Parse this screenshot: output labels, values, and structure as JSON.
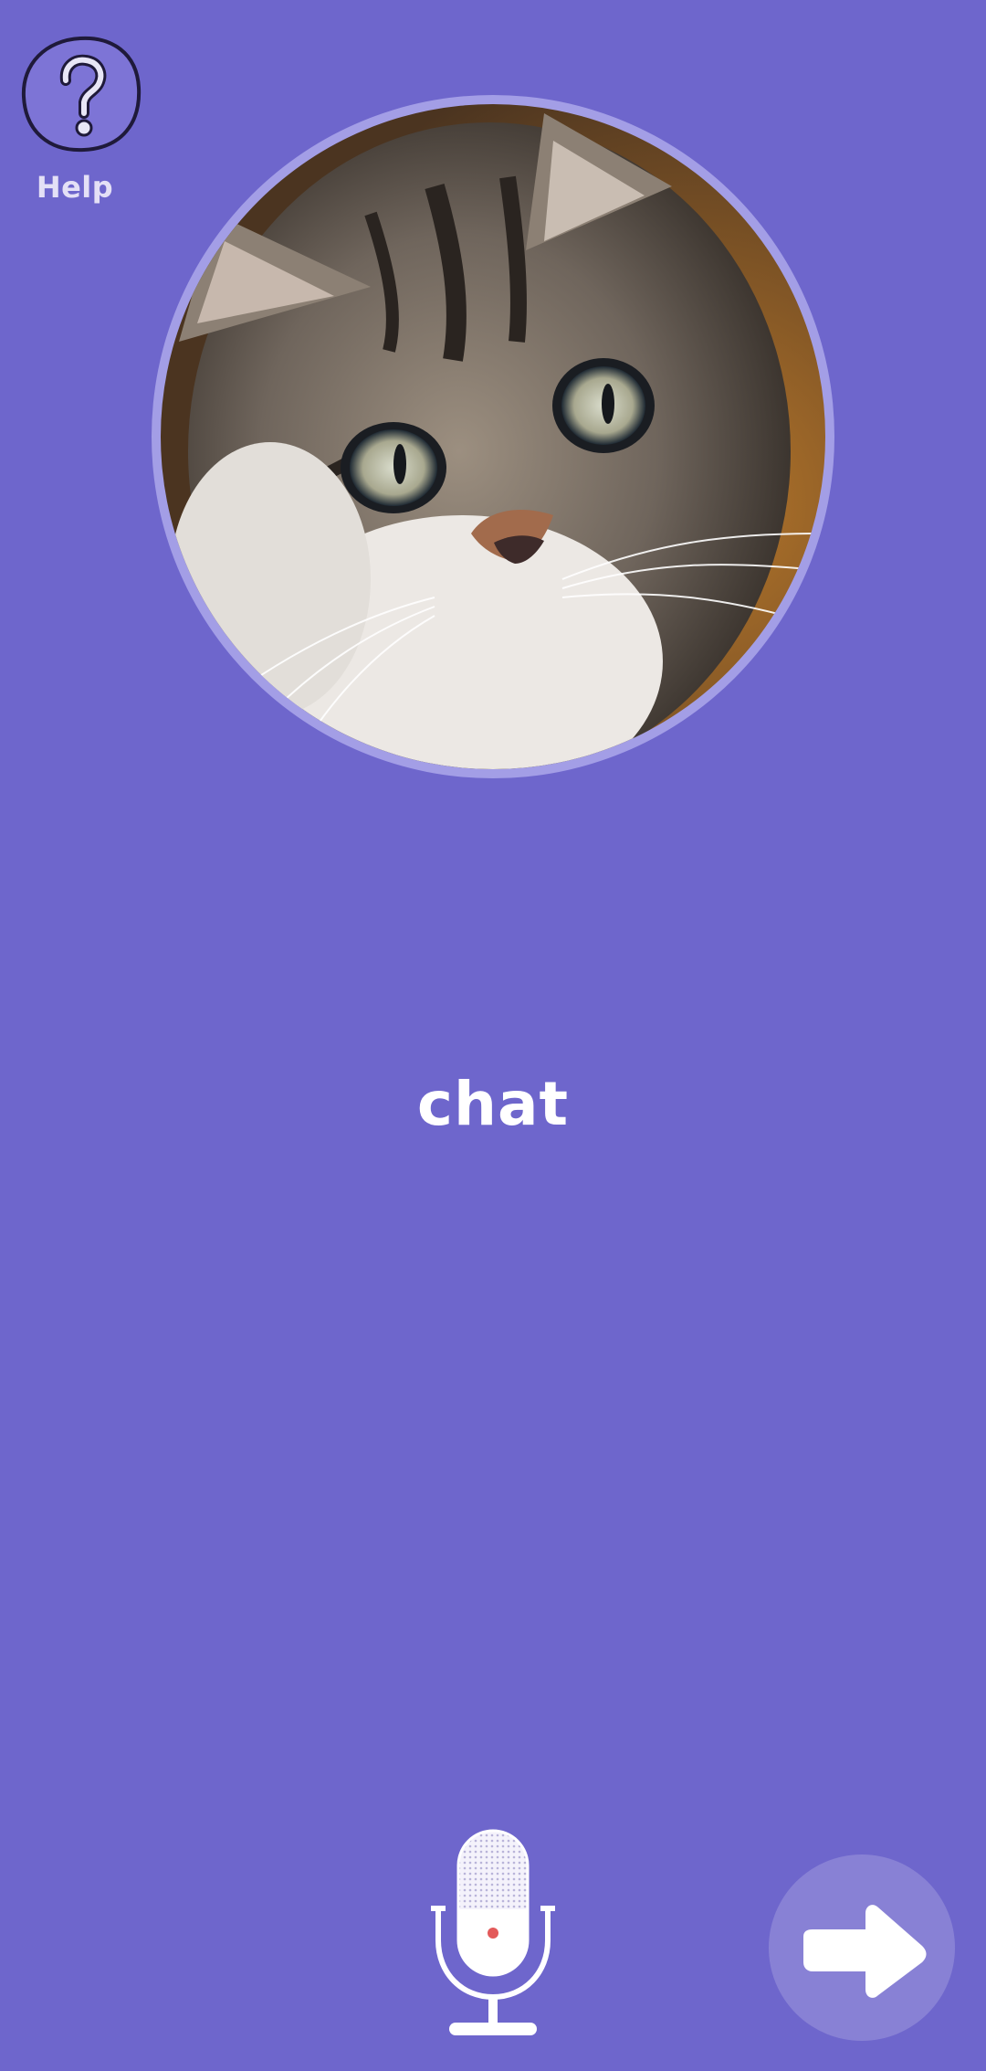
{
  "help": {
    "label": "Help",
    "icon": "question-mark-icon"
  },
  "card": {
    "image": "kitten-photo",
    "word": "chat"
  },
  "controls": {
    "microphone_icon": "microphone-icon",
    "next_icon": "arrow-right-icon"
  },
  "colors": {
    "background": "#6e66cc",
    "frame": "#a39ee6",
    "text": "#ffffff"
  }
}
